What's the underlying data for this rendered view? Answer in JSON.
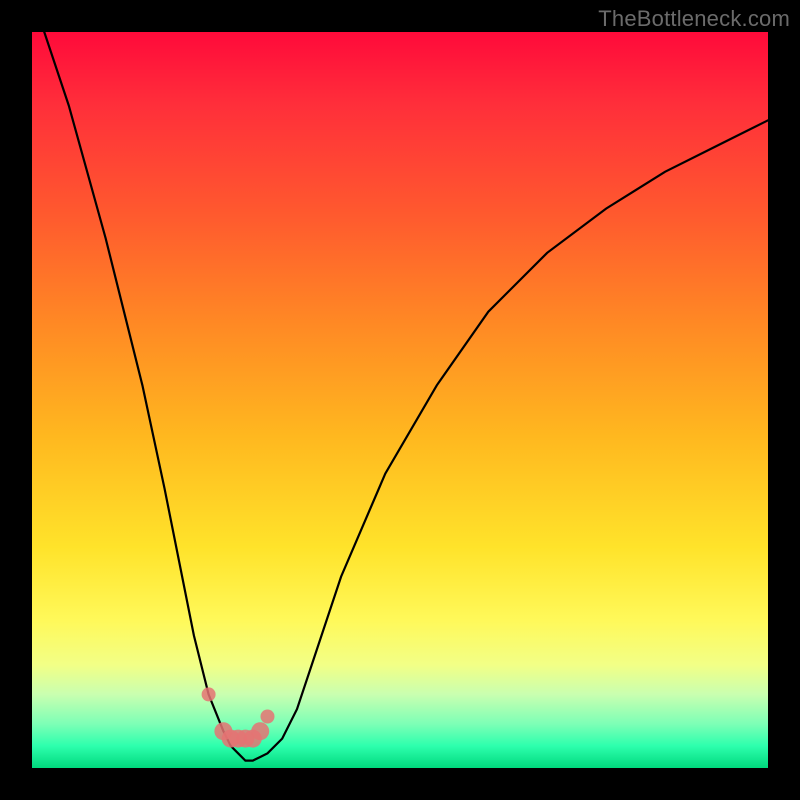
{
  "watermark": "TheBottleneck.com",
  "chart_data": {
    "type": "line",
    "title": "",
    "xlabel": "",
    "ylabel": "",
    "xlim": [
      0,
      100
    ],
    "ylim": [
      0,
      100
    ],
    "series": [
      {
        "name": "bottleneck-curve",
        "x": [
          0,
          5,
          10,
          15,
          18,
          20,
          22,
          24,
          26,
          27,
          28,
          29,
          30,
          31,
          32,
          34,
          36,
          38,
          42,
          48,
          55,
          62,
          70,
          78,
          86,
          94,
          100
        ],
        "values": [
          105,
          90,
          72,
          52,
          38,
          28,
          18,
          10,
          5,
          3,
          2,
          1,
          1,
          1.5,
          2,
          4,
          8,
          14,
          26,
          40,
          52,
          62,
          70,
          76,
          81,
          85,
          88
        ]
      }
    ],
    "markers": {
      "name": "highlight-points",
      "x": [
        24,
        26,
        27,
        28,
        29,
        30,
        31,
        32
      ],
      "values": [
        10,
        5,
        4,
        4,
        4,
        4,
        5,
        7
      ]
    },
    "gradient_stops": [
      {
        "pct": 0,
        "color": "#ff0a3a"
      },
      {
        "pct": 25,
        "color": "#ff5a2e"
      },
      {
        "pct": 55,
        "color": "#ffb81f"
      },
      {
        "pct": 80,
        "color": "#fff95a"
      },
      {
        "pct": 94,
        "color": "#7dffb6"
      },
      {
        "pct": 100,
        "color": "#00d97d"
      }
    ]
  }
}
